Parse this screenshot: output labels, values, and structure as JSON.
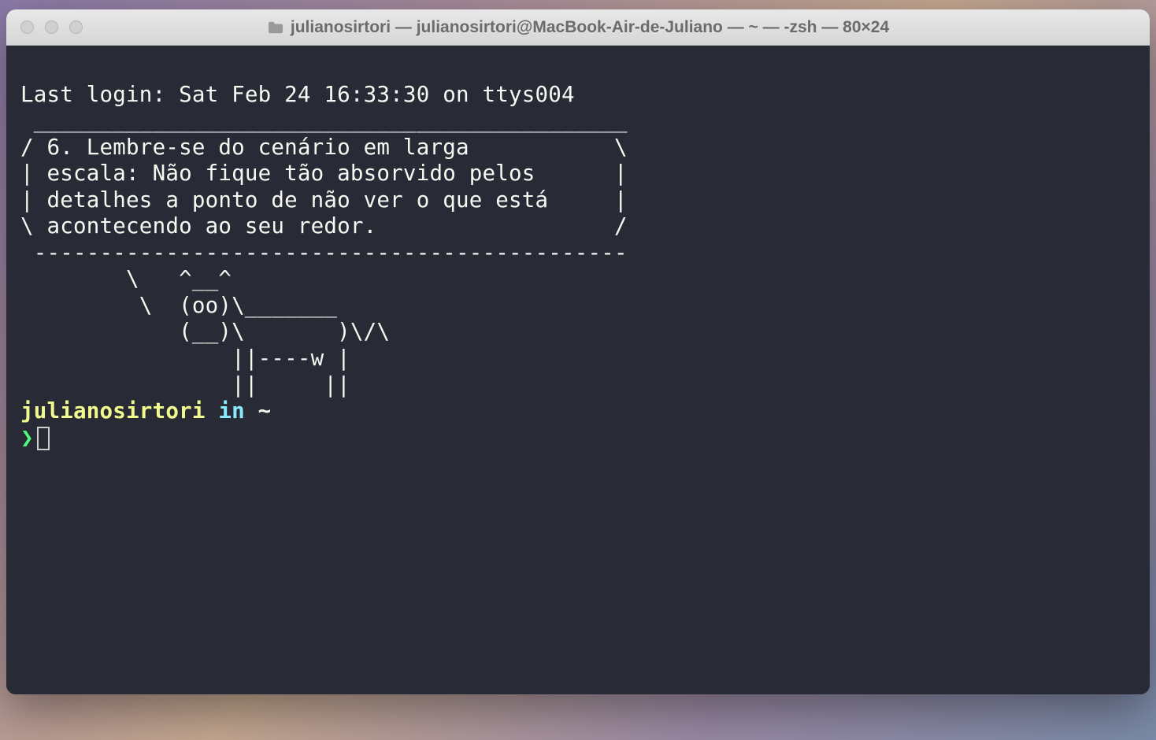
{
  "window": {
    "title": "julianosirtori — julianosirtori@MacBook-Air-de-Juliano — ~ — -zsh — 80×24"
  },
  "terminal": {
    "last_login": "Last login: Sat Feb 24 16:33:30 on ttys004",
    "cowsay": {
      "top": " _____________________________________________",
      "l1": "/ 6. Lembre-se do cenário em larga           \\",
      "l2": "| escala: Não fique tão absorvido pelos      |",
      "l3": "| detalhes a ponto de não ver o que está     |",
      "l4": "\\ acontecendo ao seu redor.                  /",
      "bottom": " ---------------------------------------------",
      "cow1": "        \\   ^__^",
      "cow2": "         \\  (oo)\\_______",
      "cow3": "            (__)\\       )\\/\\",
      "cow4": "                ||----w |",
      "cow5": "                ||     ||"
    },
    "prompt": {
      "user": "julianosirtori",
      "in": " in ",
      "path": "~",
      "symbol": "❯"
    }
  }
}
